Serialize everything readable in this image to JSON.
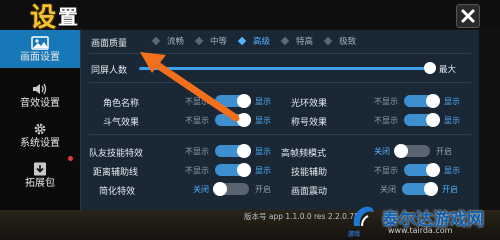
{
  "header": {
    "title_char1": "设",
    "title_char2": "置"
  },
  "sidebar": {
    "items": [
      {
        "label": "画面设置",
        "icon": "image-icon",
        "active": true
      },
      {
        "label": "音效设置",
        "icon": "speaker-icon",
        "active": false
      },
      {
        "label": "系统设置",
        "icon": "gear-icon",
        "active": false
      },
      {
        "label": "拓展包",
        "icon": "download-icon",
        "active": false
      }
    ]
  },
  "settings": {
    "quality": {
      "label": "画面质量",
      "options": [
        "流畅",
        "中等",
        "高级",
        "特高",
        "极致"
      ],
      "selected": "高级"
    },
    "players": {
      "label": "同屏人数",
      "max_label": "最大",
      "level": 1.0
    },
    "toggles": [
      {
        "label": "角色名称",
        "off": "不显示",
        "on": "显示",
        "state": "on"
      },
      {
        "label": "光环效果",
        "off": "不显示",
        "on": "显示",
        "state": "on"
      },
      {
        "label": "斗气效果",
        "off": "不显示",
        "on": "显示",
        "state": "on"
      },
      {
        "label": "称号效果",
        "off": "不显示",
        "on": "显示",
        "state": "on"
      },
      {
        "label": "队友技能特效",
        "off": "不显示",
        "on": "显示",
        "state": "on"
      },
      {
        "label": "高帧频模式",
        "off": "关闭",
        "on": "开启",
        "state": "off"
      },
      {
        "label": "距离辅助线",
        "off": "不显示",
        "on": "显示",
        "state": "on"
      },
      {
        "label": "技能辅助",
        "off": "不显示",
        "on": "显示",
        "state": "on"
      },
      {
        "label": "简化特效",
        "off": "关闭",
        "on": "开启",
        "state": "off"
      },
      {
        "label": "画面震动",
        "off": "关闭",
        "on": "开启",
        "state": "on"
      }
    ]
  },
  "footer": {
    "version": "版本号  app 1.1.0.0   res 2.2.0.75"
  },
  "watermark": {
    "name": "泰尔达游戏网",
    "url": "www.tairda.com",
    "sub": "游戏"
  },
  "colors": {
    "accent": "#3d8fd0",
    "highlight": "#4fb3ff",
    "arrow": "#f2701c"
  }
}
